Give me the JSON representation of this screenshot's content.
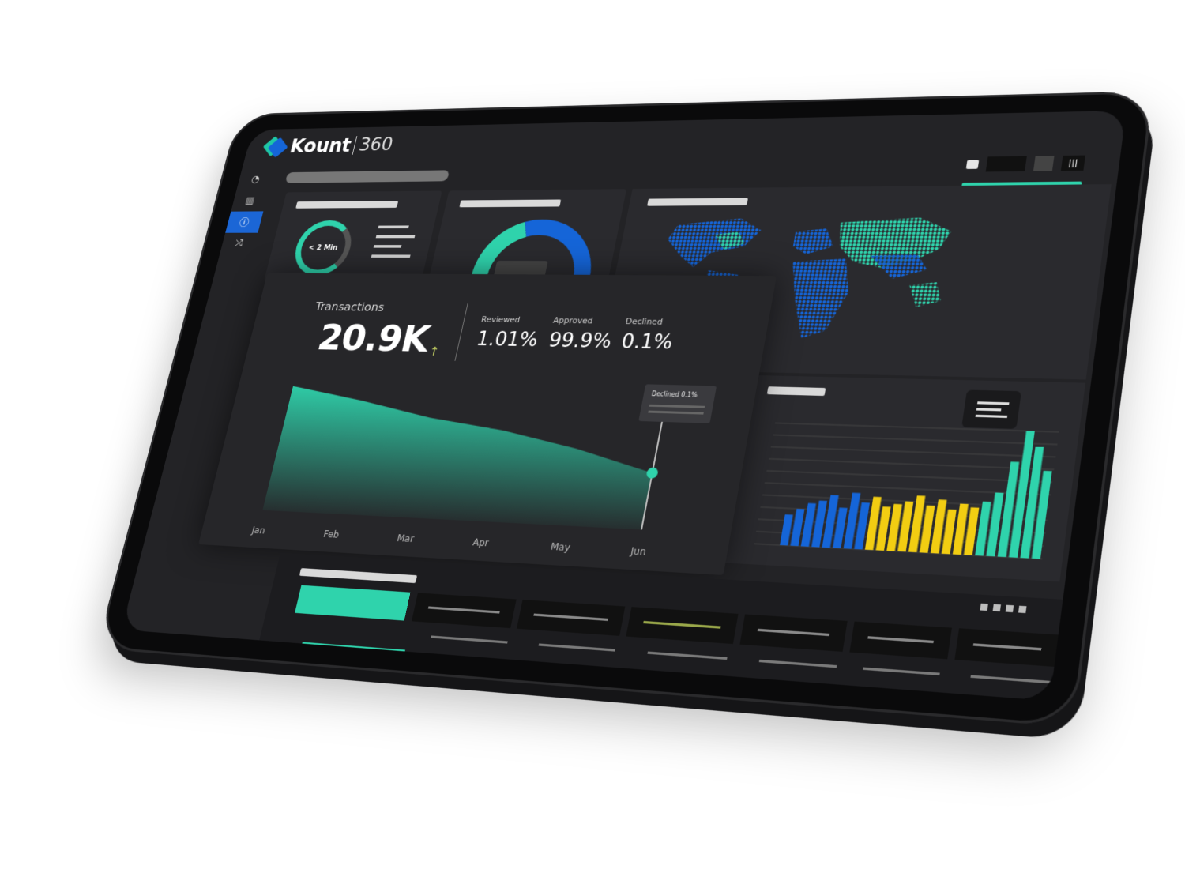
{
  "app": {
    "brand_name": "Kount",
    "brand_suffix": "360"
  },
  "sidebar": {
    "items": [
      {
        "icon": "gauge-icon",
        "glyph": "◔"
      },
      {
        "icon": "bar-chart-icon",
        "glyph": "▥"
      },
      {
        "icon": "info-icon",
        "glyph": "ⓘ",
        "active": true
      },
      {
        "icon": "shuffle-icon",
        "glyph": "⤮"
      }
    ]
  },
  "header": {
    "menu_glyph": "|||"
  },
  "gauge_card": {
    "gauge_label": "< 2 Min"
  },
  "transactions": {
    "label": "Transactions",
    "value": "20.9K",
    "trend_glyph": "↑",
    "stats": [
      {
        "label": "Reviewed",
        "value": "1.01%"
      },
      {
        "label": "Approved",
        "value": "99.9%"
      },
      {
        "label": "Declined",
        "value": "0.1%"
      }
    ],
    "tooltip": "Declined 0.1%"
  },
  "chart_data": [
    {
      "type": "area",
      "x": [
        "Jan",
        "Feb",
        "Mar",
        "Apr",
        "May",
        "Jun"
      ],
      "series": [
        {
          "values": [
            100,
            90,
            78,
            70,
            58,
            42
          ]
        }
      ],
      "grid": false
    },
    {
      "type": "bar",
      "series": [
        {
          "values": [
            20,
            24,
            28,
            30,
            34,
            26,
            36,
            30,
            34,
            28,
            30,
            32,
            36,
            30,
            34,
            28,
            32,
            30,
            34,
            40,
            60,
            80,
            70,
            55
          ]
        }
      ],
      "grid": true
    }
  ],
  "colors": {
    "accent_teal": "#2fd3ac",
    "brand_blue": "#1565d8",
    "bar_yellow": "#f2cd12",
    "background": "#232326"
  }
}
